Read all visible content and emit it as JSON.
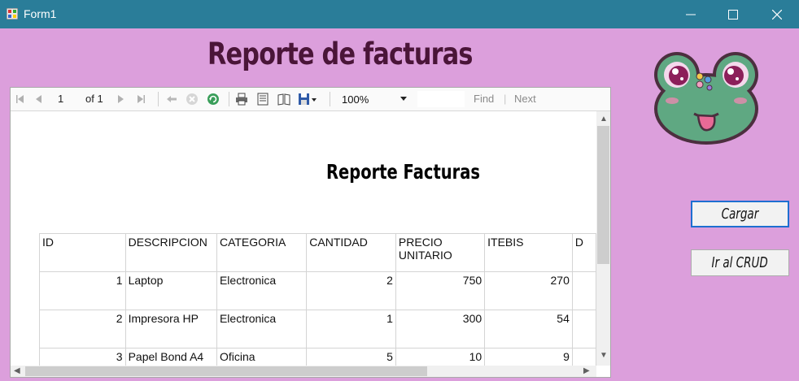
{
  "window": {
    "title": "Form1"
  },
  "heading": "Reporte de facturas",
  "viewer": {
    "toolbar": {
      "page_current": "1",
      "page_of": "of 1",
      "zoom": "100%",
      "find_label": "Find",
      "find_sep": "|",
      "next_label": "Next"
    },
    "report": {
      "title": "Reporte Facturas",
      "headers": [
        "ID",
        "DESCRIPCION",
        "CATEGORIA",
        "CANTIDAD",
        "PRECIO UNITARIO",
        "ITEBIS",
        "D"
      ],
      "rows": [
        [
          "1",
          "Laptop",
          "Electronica",
          "2",
          "750",
          "270"
        ],
        [
          "2",
          "Impresora HP",
          "Electronica",
          "1",
          "300",
          "54"
        ],
        [
          "3",
          "Papel Bond A4",
          "Oficina",
          "5",
          "10",
          "9"
        ]
      ]
    }
  },
  "buttons": {
    "cargar": "Cargar",
    "crud": "Ir al CRUD"
  }
}
